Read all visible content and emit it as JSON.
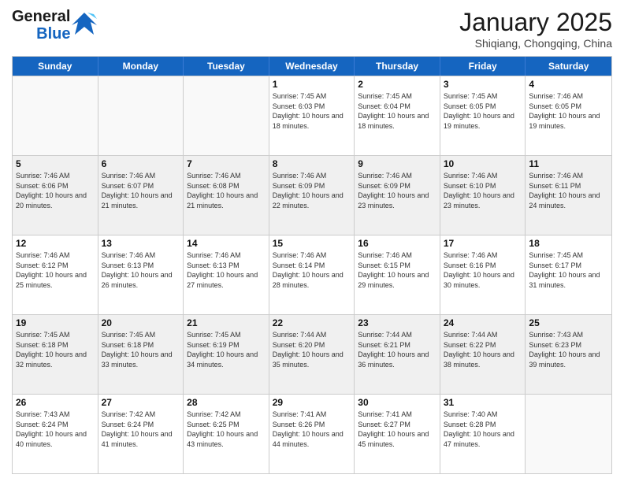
{
  "header": {
    "logo_general": "General",
    "logo_blue": "Blue",
    "month_title": "January 2025",
    "subtitle": "Shiqiang, Chongqing, China"
  },
  "weekdays": [
    "Sunday",
    "Monday",
    "Tuesday",
    "Wednesday",
    "Thursday",
    "Friday",
    "Saturday"
  ],
  "weeks": [
    [
      {
        "day": "",
        "empty": true
      },
      {
        "day": "",
        "empty": true
      },
      {
        "day": "",
        "empty": true
      },
      {
        "day": "1",
        "sunrise": "7:45 AM",
        "sunset": "6:03 PM",
        "daylight": "10 hours and 18 minutes."
      },
      {
        "day": "2",
        "sunrise": "7:45 AM",
        "sunset": "6:04 PM",
        "daylight": "10 hours and 18 minutes."
      },
      {
        "day": "3",
        "sunrise": "7:45 AM",
        "sunset": "6:05 PM",
        "daylight": "10 hours and 19 minutes."
      },
      {
        "day": "4",
        "sunrise": "7:46 AM",
        "sunset": "6:05 PM",
        "daylight": "10 hours and 19 minutes."
      }
    ],
    [
      {
        "day": "5",
        "sunrise": "7:46 AM",
        "sunset": "6:06 PM",
        "daylight": "10 hours and 20 minutes."
      },
      {
        "day": "6",
        "sunrise": "7:46 AM",
        "sunset": "6:07 PM",
        "daylight": "10 hours and 21 minutes."
      },
      {
        "day": "7",
        "sunrise": "7:46 AM",
        "sunset": "6:08 PM",
        "daylight": "10 hours and 21 minutes."
      },
      {
        "day": "8",
        "sunrise": "7:46 AM",
        "sunset": "6:09 PM",
        "daylight": "10 hours and 22 minutes."
      },
      {
        "day": "9",
        "sunrise": "7:46 AM",
        "sunset": "6:09 PM",
        "daylight": "10 hours and 23 minutes."
      },
      {
        "day": "10",
        "sunrise": "7:46 AM",
        "sunset": "6:10 PM",
        "daylight": "10 hours and 23 minutes."
      },
      {
        "day": "11",
        "sunrise": "7:46 AM",
        "sunset": "6:11 PM",
        "daylight": "10 hours and 24 minutes."
      }
    ],
    [
      {
        "day": "12",
        "sunrise": "7:46 AM",
        "sunset": "6:12 PM",
        "daylight": "10 hours and 25 minutes."
      },
      {
        "day": "13",
        "sunrise": "7:46 AM",
        "sunset": "6:13 PM",
        "daylight": "10 hours and 26 minutes."
      },
      {
        "day": "14",
        "sunrise": "7:46 AM",
        "sunset": "6:13 PM",
        "daylight": "10 hours and 27 minutes."
      },
      {
        "day": "15",
        "sunrise": "7:46 AM",
        "sunset": "6:14 PM",
        "daylight": "10 hours and 28 minutes."
      },
      {
        "day": "16",
        "sunrise": "7:46 AM",
        "sunset": "6:15 PM",
        "daylight": "10 hours and 29 minutes."
      },
      {
        "day": "17",
        "sunrise": "7:46 AM",
        "sunset": "6:16 PM",
        "daylight": "10 hours and 30 minutes."
      },
      {
        "day": "18",
        "sunrise": "7:45 AM",
        "sunset": "6:17 PM",
        "daylight": "10 hours and 31 minutes."
      }
    ],
    [
      {
        "day": "19",
        "sunrise": "7:45 AM",
        "sunset": "6:18 PM",
        "daylight": "10 hours and 32 minutes."
      },
      {
        "day": "20",
        "sunrise": "7:45 AM",
        "sunset": "6:18 PM",
        "daylight": "10 hours and 33 minutes."
      },
      {
        "day": "21",
        "sunrise": "7:45 AM",
        "sunset": "6:19 PM",
        "daylight": "10 hours and 34 minutes."
      },
      {
        "day": "22",
        "sunrise": "7:44 AM",
        "sunset": "6:20 PM",
        "daylight": "10 hours and 35 minutes."
      },
      {
        "day": "23",
        "sunrise": "7:44 AM",
        "sunset": "6:21 PM",
        "daylight": "10 hours and 36 minutes."
      },
      {
        "day": "24",
        "sunrise": "7:44 AM",
        "sunset": "6:22 PM",
        "daylight": "10 hours and 38 minutes."
      },
      {
        "day": "25",
        "sunrise": "7:43 AM",
        "sunset": "6:23 PM",
        "daylight": "10 hours and 39 minutes."
      }
    ],
    [
      {
        "day": "26",
        "sunrise": "7:43 AM",
        "sunset": "6:24 PM",
        "daylight": "10 hours and 40 minutes."
      },
      {
        "day": "27",
        "sunrise": "7:42 AM",
        "sunset": "6:24 PM",
        "daylight": "10 hours and 41 minutes."
      },
      {
        "day": "28",
        "sunrise": "7:42 AM",
        "sunset": "6:25 PM",
        "daylight": "10 hours and 43 minutes."
      },
      {
        "day": "29",
        "sunrise": "7:41 AM",
        "sunset": "6:26 PM",
        "daylight": "10 hours and 44 minutes."
      },
      {
        "day": "30",
        "sunrise": "7:41 AM",
        "sunset": "6:27 PM",
        "daylight": "10 hours and 45 minutes."
      },
      {
        "day": "31",
        "sunrise": "7:40 AM",
        "sunset": "6:28 PM",
        "daylight": "10 hours and 47 minutes."
      },
      {
        "day": "",
        "empty": true
      }
    ]
  ],
  "labels": {
    "sunrise": "Sunrise:",
    "sunset": "Sunset:",
    "daylight": "Daylight:"
  }
}
